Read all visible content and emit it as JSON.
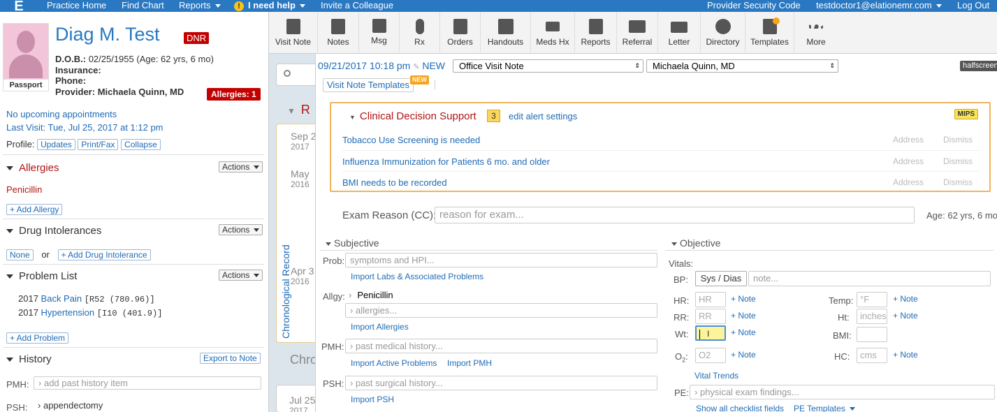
{
  "topnav": {
    "logo": "E",
    "items": [
      "Practice Home",
      "Find Chart",
      "Reports",
      "I need help",
      "Invite a Colleague"
    ],
    "help_icon": "!",
    "right": [
      "Provider Security Code",
      "testdoctor1@elationemr.com",
      "Log Out"
    ]
  },
  "patient": {
    "name": "Diag M. Test",
    "dnr": "DNR",
    "passport": "Passport",
    "dob_label": "D.O.B.:",
    "dob_value": "02/25/1955 (Age: 62 yrs, 6 mo)",
    "insurance_label": "Insurance:",
    "phone_label": "Phone:",
    "provider_label": "Provider:",
    "provider_value": "Michaela Quinn, MD",
    "allergies_badge": "Allergies: 1",
    "upcoming": "No upcoming appointments",
    "last_visit": "Last Visit: Tue, Jul 25, 2017 at 1:12 pm",
    "profile_label": "Profile:",
    "profile_buttons": [
      "Updates",
      "Print/Fax",
      "Collapse"
    ]
  },
  "sidebar": {
    "actions_label": "Actions",
    "allergies": {
      "title": "Allergies",
      "items": [
        "Penicillin"
      ],
      "add": "+ Add Allergy"
    },
    "intolerances": {
      "title": "Drug Intolerances",
      "none": "None",
      "or": "or",
      "add": "+ Add Drug Intolerance"
    },
    "problems": {
      "title": "Problem List",
      "items": [
        {
          "year": "2017",
          "name": "Back Pain",
          "code": "[R52 (780.96)]"
        },
        {
          "year": "2017",
          "name": "Hypertension",
          "code": "[I10 (401.9)]"
        }
      ],
      "add": "+ Add Problem"
    },
    "history": {
      "title": "History",
      "export": "Export to Note",
      "pmh_label": "PMH:",
      "pmh_placeholder": "add past history item",
      "psh_label": "PSH:",
      "psh_value": "appendectomy"
    }
  },
  "toolbar": {
    "tools": [
      {
        "label": "Visit Note",
        "icon": "document-icon"
      },
      {
        "label": "Notes",
        "icon": "notes-icon"
      },
      {
        "label": "Msg",
        "icon": "message-icon"
      },
      {
        "label": "Rx",
        "icon": "pill-icon"
      },
      {
        "label": "Orders",
        "icon": "orders-icon"
      },
      {
        "label": "Handouts",
        "icon": "handouts-icon"
      },
      {
        "label": "Meds Hx",
        "icon": "meds-icon"
      },
      {
        "label": "Reports",
        "icon": "reports-icon"
      },
      {
        "label": "Referral",
        "icon": "referral-icon"
      },
      {
        "label": "Letter",
        "icon": "letter-icon"
      },
      {
        "label": "Directory",
        "icon": "directory-icon"
      },
      {
        "label": "Templates",
        "icon": "templates-icon"
      },
      {
        "label": "More",
        "icon": "more-icon"
      }
    ]
  },
  "midstrip": {
    "search_icon": "search-icon",
    "section_letter": "R",
    "dates": [
      {
        "month": "Sep 2",
        "year": "2017"
      },
      {
        "month": "May",
        "year": "2016"
      },
      {
        "month": "Apr 3",
        "year": "2016"
      },
      {
        "month": "Jul 25",
        "year": "2017"
      }
    ],
    "chron_label": "Chronological Record",
    "chr_label": "Chro"
  },
  "note": {
    "datetime": "09/21/2017 10:18 pm",
    "new_label": "NEW",
    "note_type": "Office Visit Note",
    "provider": "Michaela Quinn, MD",
    "halfscreen": "halfscreen",
    "templates_btn": "Visit Note Templates",
    "templates_new": "NEW",
    "cds": {
      "title": "Clinical Decision Support",
      "count": "3",
      "edit": "edit alert settings",
      "mips": "MIPS",
      "address": "Address",
      "dismiss": "Dismiss",
      "alerts": [
        "Tobacco Use Screening is needed",
        "Influenza Immunization for Patients 6 mo. and older",
        "BMI needs to be recorded"
      ]
    },
    "exam_reason_label": "Exam Reason (CC):",
    "exam_reason_placeholder": "reason for exam...",
    "age": "Age: 62 yrs, 6 mo",
    "subjective": {
      "title": "Subjective",
      "prob_label": "Prob:",
      "prob_placeholder": "symptoms and HPI...",
      "import_labs": "Import Labs & Associated Problems",
      "allgy_label": "Allgy:",
      "allgy_value": "Penicillin",
      "allergies_placeholder": "allergies...",
      "import_allergies": "Import Allergies",
      "pmh_label": "PMH:",
      "pmh_placeholder": "past medical history...",
      "import_active": "Import Active Problems",
      "import_pmh": "Import PMH",
      "psh_label": "PSH:",
      "psh_placeholder": "past surgical history...",
      "import_psh": "Import PSH"
    },
    "objective": {
      "title": "Objective",
      "vitals_label": "Vitals:",
      "bp_label": "BP:",
      "bp_button": "Sys / Dias",
      "bp_note_placeholder": "note...",
      "hr_label": "HR:",
      "hr_placeholder": "HR",
      "rr_label": "RR:",
      "rr_placeholder": "RR",
      "wt_label": "Wt:",
      "o2_label": "O",
      "o2_sub": "2",
      "o2_placeholder": "O2",
      "temp_label": "Temp:",
      "temp_placeholder": "°F",
      "ht_label": "Ht:",
      "ht_placeholder": "inches",
      "bmi_label": "BMI:",
      "hc_label": "HC:",
      "hc_placeholder": "cms",
      "note_link": "+ Note",
      "vital_trends": "Vital Trends",
      "pe_label": "PE:",
      "pe_placeholder": "physical exam findings...",
      "show_checklist": "Show all checklist fields",
      "pe_templates": "PE Templates"
    }
  }
}
